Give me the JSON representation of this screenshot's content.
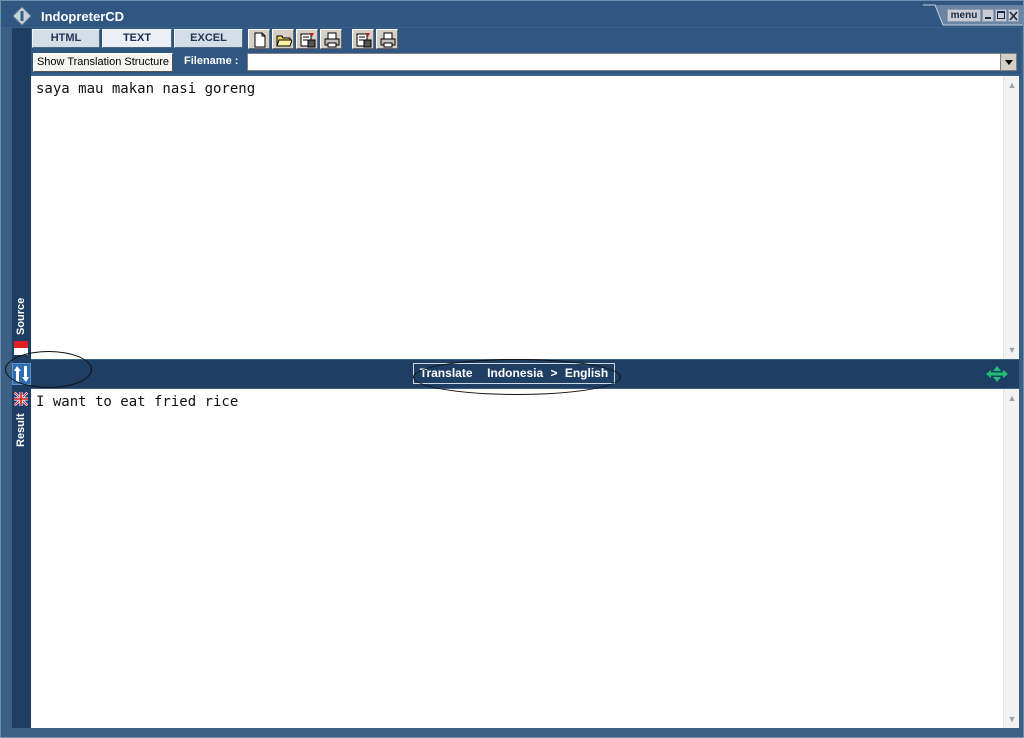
{
  "window": {
    "title": "IndopreterCD",
    "menu_label": "menu",
    "controls": [
      "minimize",
      "maximize",
      "close"
    ]
  },
  "toolbar": {
    "tabs": [
      {
        "label": "HTML",
        "active": false
      },
      {
        "label": "TEXT",
        "active": true
      },
      {
        "label": "EXCEL",
        "active": false
      }
    ],
    "tools": [
      "new-file-icon",
      "open-folder-icon",
      "save-icon",
      "print-icon",
      "save-result-icon",
      "print-result-icon"
    ]
  },
  "row2": {
    "show_structure_label": "Show Translation Structure",
    "filename_label": "Filename :",
    "filename_value": ""
  },
  "source": {
    "side_label": "Source",
    "text": "saya mau makan nasi goreng",
    "flag": "indonesia-flag-icon"
  },
  "translate": {
    "label": "Translate  Indonesia > English",
    "swap_icon": "swap-direction-icon"
  },
  "result": {
    "side_label": "Result",
    "text": "I want to eat fried rice",
    "flag": "uk-flag-icon"
  },
  "colors": {
    "frame": "#2f5782",
    "strip": "#1f3e63",
    "accent_green": "#20c070"
  }
}
